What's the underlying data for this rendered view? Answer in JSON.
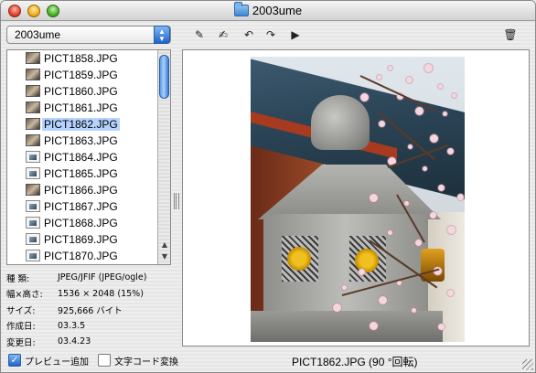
{
  "window": {
    "title": "2003ume"
  },
  "toolbar": {
    "folder_popup": "2003ume",
    "icons": [
      "edit-icon",
      "rename-icon",
      "rotate-left-icon",
      "rotate-right-icon",
      "play-icon",
      "trash-icon"
    ]
  },
  "file_list": {
    "items": [
      {
        "name": "PICT1858.JPG",
        "thumb": "photo"
      },
      {
        "name": "PICT1859.JPG",
        "thumb": "photo"
      },
      {
        "name": "PICT1860.JPG",
        "thumb": "photo"
      },
      {
        "name": "PICT1861.JPG",
        "thumb": "photo"
      },
      {
        "name": "PICT1862.JPG",
        "thumb": "photo",
        "selected": true
      },
      {
        "name": "PICT1863.JPG",
        "thumb": "photo"
      },
      {
        "name": "PICT1864.JPG",
        "thumb": "doc"
      },
      {
        "name": "PICT1865.JPG",
        "thumb": "doc"
      },
      {
        "name": "PICT1866.JPG",
        "thumb": "photo"
      },
      {
        "name": "PICT1867.JPG",
        "thumb": "doc"
      },
      {
        "name": "PICT1868.JPG",
        "thumb": "doc"
      },
      {
        "name": "PICT1869.JPG",
        "thumb": "doc"
      },
      {
        "name": "PICT1870.JPG",
        "thumb": "doc"
      }
    ]
  },
  "info": {
    "kind_label": "種 類:",
    "kind_value": "JPEG/JFIF (JPEG/ogle)",
    "dimensions_label": "幅×高さ:",
    "dimensions_value": "1536 × 2048 (15%)",
    "size_label": "サイズ:",
    "size_value": "925,666 バイト",
    "created_label": "作成日:",
    "created_value": "03.3.5",
    "modified_label": "変更日:",
    "modified_value": "03.4.23"
  },
  "status": {
    "preview_add_label": "プレビュー追加",
    "preview_add_checked": true,
    "charcode_label": "文字コード変換",
    "charcode_checked": false,
    "caption": "PICT1862.JPG (90 °回転)"
  },
  "colors": {
    "selection": "#b5d3ff",
    "accent": "#1f63c8"
  }
}
